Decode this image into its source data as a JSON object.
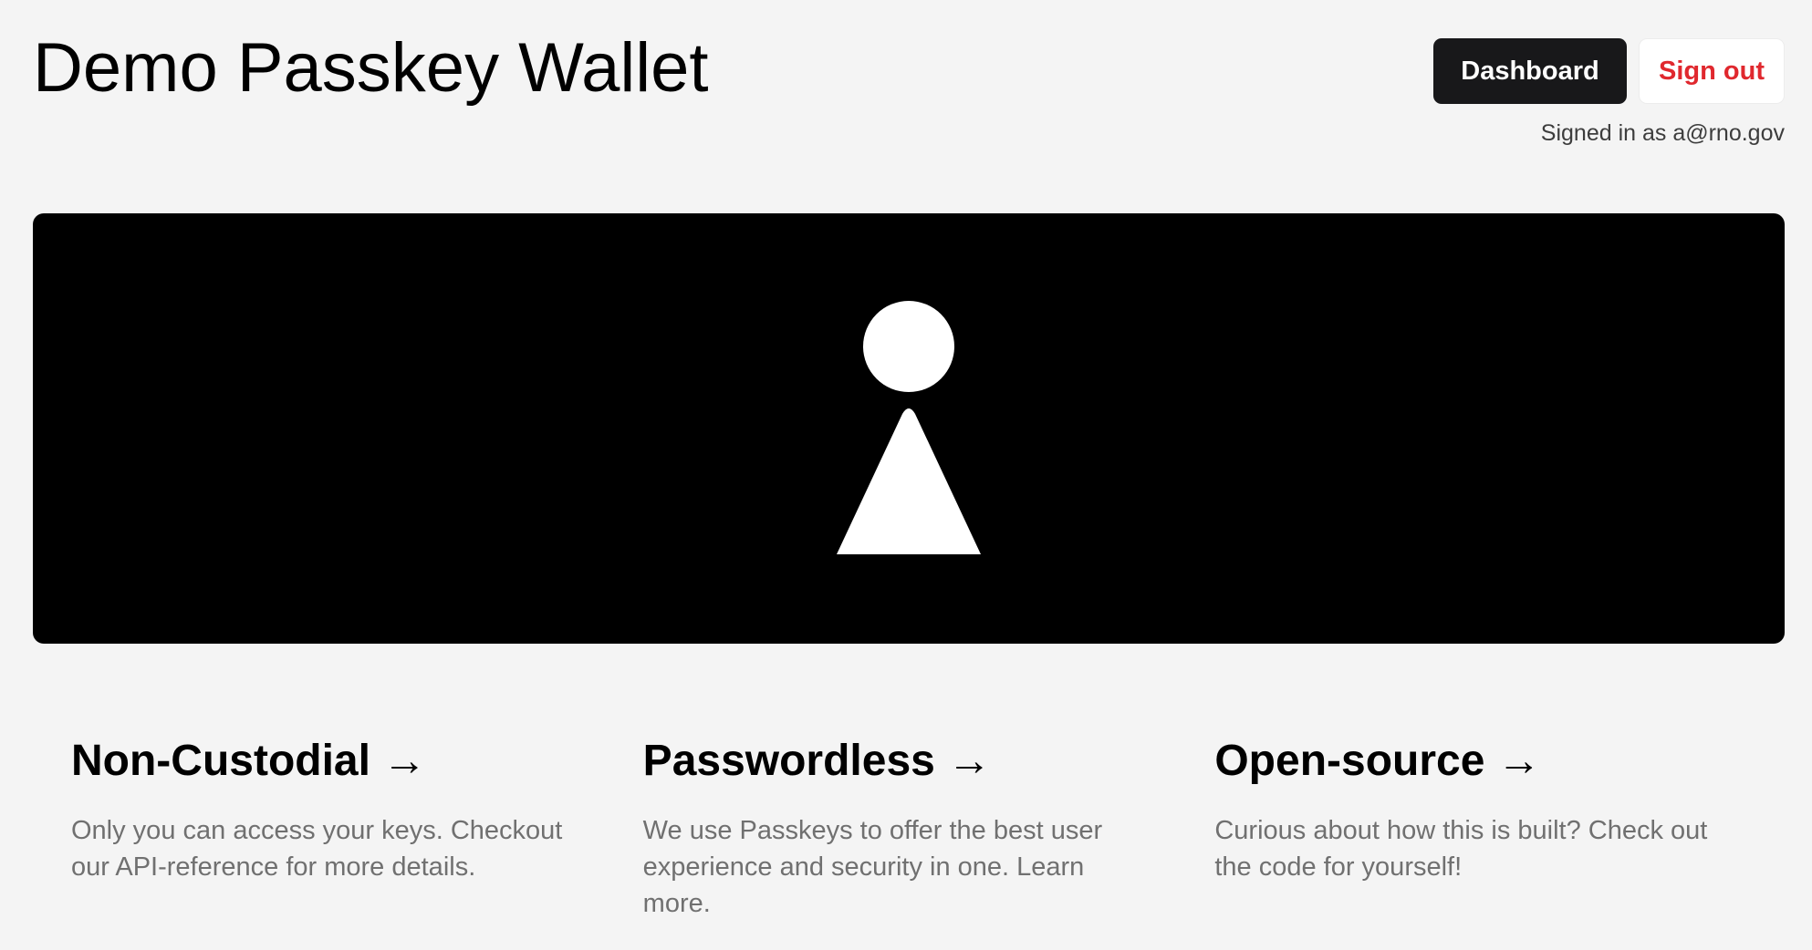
{
  "header": {
    "title": "Demo Passkey Wallet",
    "dashboard_label": "Dashboard",
    "signout_label": "Sign out",
    "signed_in_text": "Signed in as a@rno.gov"
  },
  "hero": {
    "icon": "keyhole-icon",
    "background": "#000000",
    "foreground": "#ffffff"
  },
  "features": [
    {
      "title": "Non-Custodial →",
      "text": "Only you can access your keys. Checkout our API-reference for more details."
    },
    {
      "title": "Passwordless →",
      "text": "We use Passkeys to offer the best user experience and security in one. Learn more."
    },
    {
      "title": "Open-source →",
      "text": "Curious about how this is built? Check out the code for yourself!"
    }
  ],
  "colors": {
    "page_background": "#f4f4f4",
    "primary_button": "#18181a",
    "signout_text": "#e0282e"
  }
}
